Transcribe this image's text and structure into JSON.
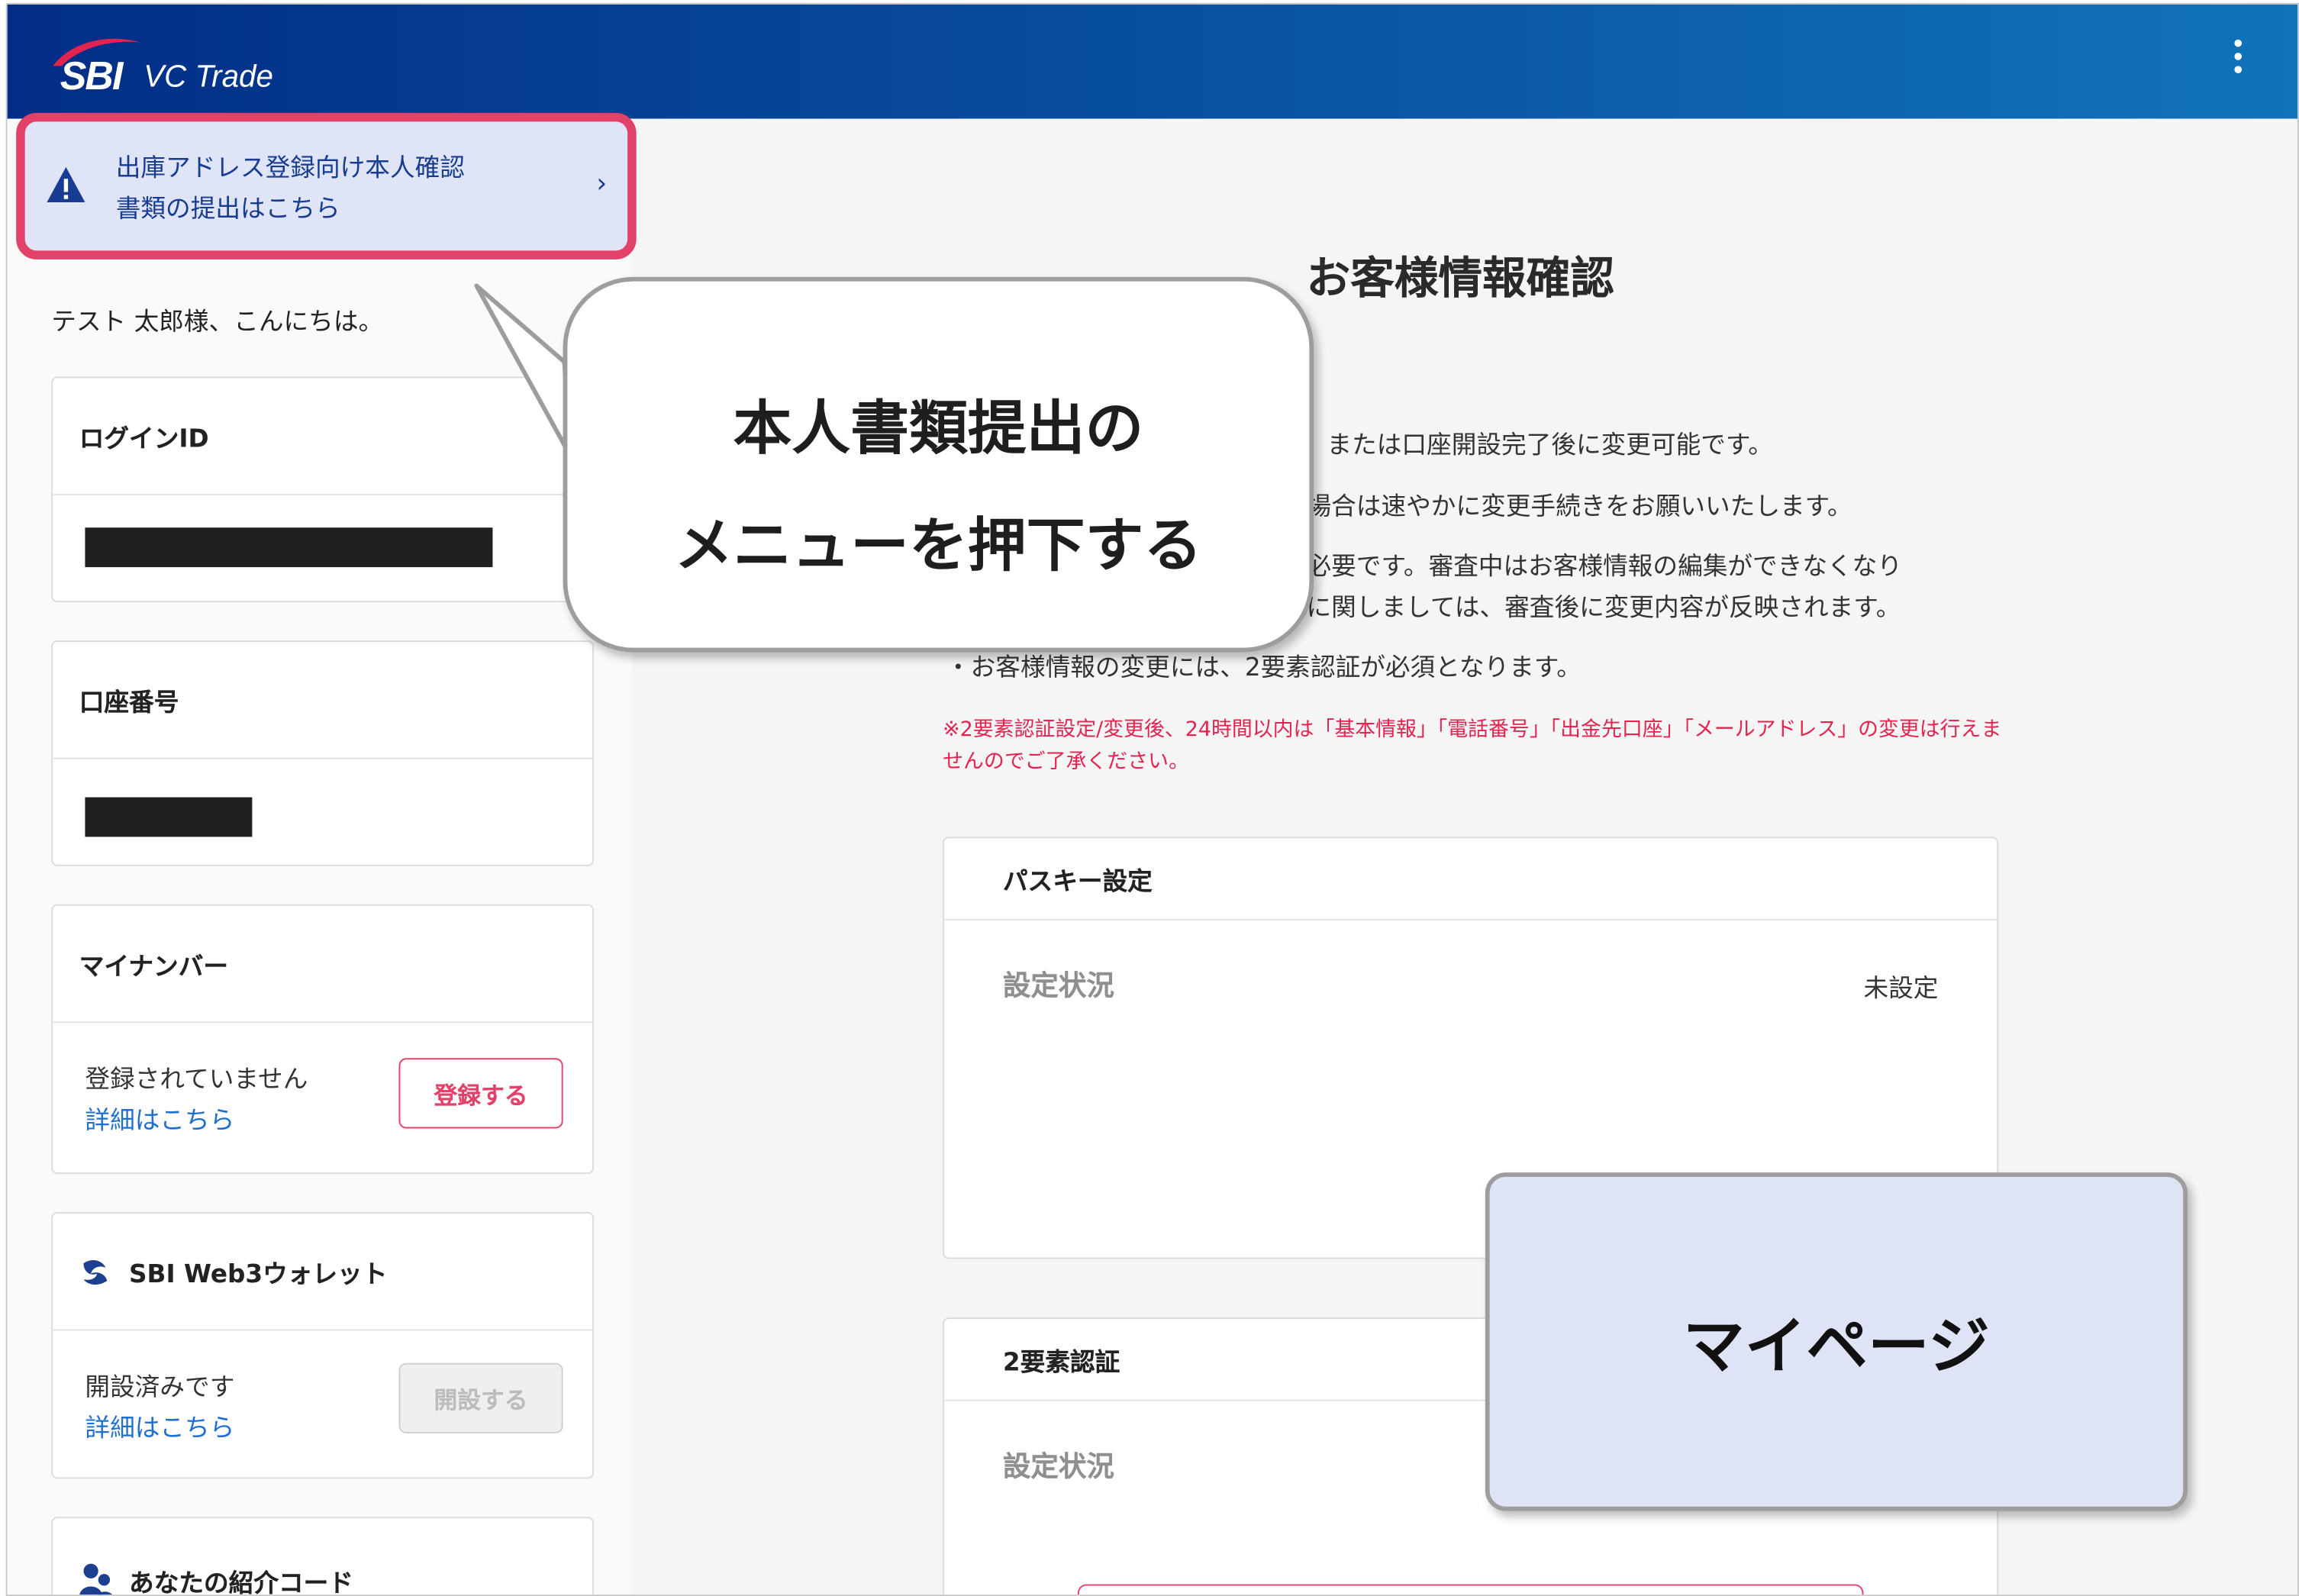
{
  "header": {
    "brand_sbi": "SBI",
    "brand_vc": "VC Trade",
    "menu_icon": "kebab-menu-icon"
  },
  "notice": {
    "line1": "出庫アドレス登録向け本人確認",
    "line2": "書類の提出はこちら",
    "chevron": "›"
  },
  "sidebar": {
    "greeting": "テスト 太郎様、こんにちは。",
    "login_id_title": "ログインID",
    "account_title": "口座番号",
    "mynumber": {
      "title": "マイナンバー",
      "status": "登録されていません",
      "link": "詳細はこちら",
      "button": "登録する"
    },
    "web3": {
      "title": "SBI Web3ウォレット",
      "status": "開設済みです",
      "link": "詳細はこちら",
      "button": "開設する"
    },
    "referral_title": "あなたの紹介コード"
  },
  "main": {
    "title": "お客様情報確認",
    "notes": [
      "または口座開設完了後に変更可能です。",
      "場合は速やかに変更手続きをお願いいたします。",
      "必要です。審査中はお客様情報の編集ができなくなり",
      "に関しましては、審査後に変更内容が反映されます。",
      "・お客様情報の変更には、2要素認証が必須となります。"
    ],
    "warning": "※2要素認証設定/変更後、24時間以内は「基本情報」「電話番号」「出金先口座」「メールアドレス」の変更は行えませんのでご了承ください。",
    "passkey": {
      "title": "パスキー設定",
      "label": "設定状況",
      "value": "未設定"
    },
    "twofa": {
      "title": "2要素認証",
      "label": "設定状況"
    }
  },
  "callout": {
    "line1": "本人書類提出の",
    "line2": "メニューを押下する"
  },
  "mypage_label": "マイページ",
  "colors": {
    "header_start": "#022d86",
    "header_end": "#1173ba",
    "accent_red": "#e2416a",
    "link_blue": "#1f6fd1",
    "notice_bg": "#dfe4f6"
  }
}
